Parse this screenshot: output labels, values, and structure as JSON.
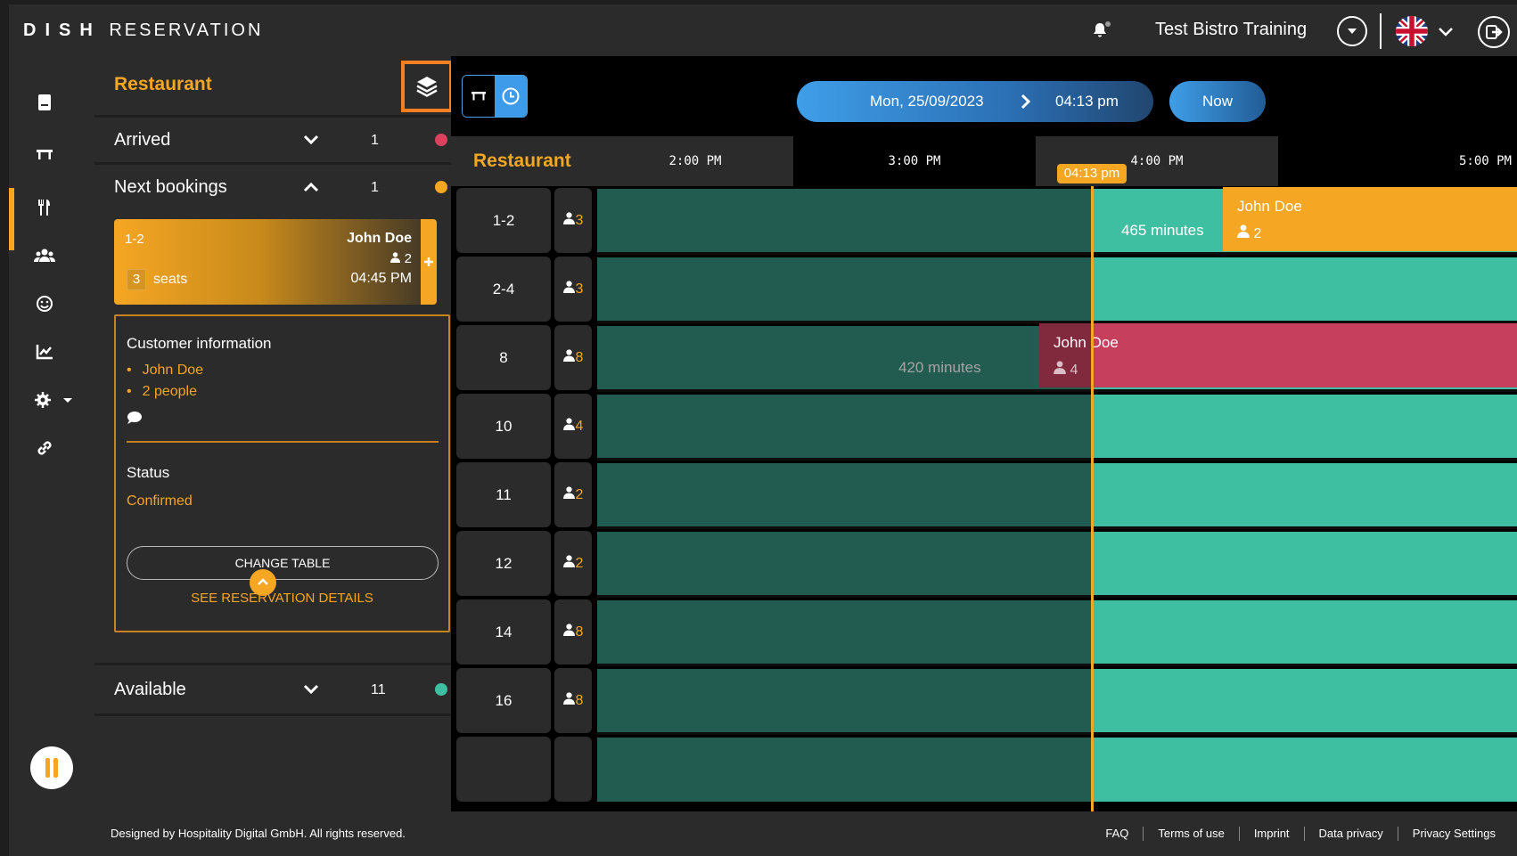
{
  "header": {
    "brand_bold": "DISH",
    "brand_rest": "RESERVATION",
    "venue": "Test Bistro Training"
  },
  "panel": {
    "title": "Restaurant",
    "sections": {
      "arrived": {
        "label": "Arrived",
        "count": "1",
        "color": "#d9415f"
      },
      "next": {
        "label": "Next bookings",
        "count": "1",
        "color": "#f5a623"
      },
      "available": {
        "label": "Available",
        "count": "11",
        "color": "#3fbfa1"
      }
    },
    "booking": {
      "table": "1-2",
      "name": "John Doe",
      "people": "2",
      "seats_num": "3",
      "seats_label": "seats",
      "time": "04:45 PM"
    },
    "customer": {
      "title": "Customer information",
      "name": "John Doe",
      "people": "2 people",
      "status_label": "Status",
      "status": "Confirmed",
      "change_table": "CHANGE TABLE",
      "details": "SEE RESERVATION DETAILS"
    }
  },
  "timeline": {
    "date": "Mon, 25/09/2023",
    "time": "04:13 pm",
    "now_button": "Now",
    "area_label": "Restaurant",
    "hours": [
      "2:00 PM",
      "3:00 PM",
      "4:00 PM",
      "5:00 PM"
    ],
    "now_tag": "04:13 pm",
    "rows": [
      {
        "table": "1-2",
        "cap": "3"
      },
      {
        "table": "2-4",
        "cap": "3"
      },
      {
        "table": "8",
        "cap": "8"
      },
      {
        "table": "10",
        "cap": "4"
      },
      {
        "table": "11",
        "cap": "2"
      },
      {
        "table": "12",
        "cap": "2"
      },
      {
        "table": "14",
        "cap": "8"
      },
      {
        "table": "16",
        "cap": "8"
      }
    ],
    "bookings": {
      "orange": {
        "name": "John Doe",
        "people": "2",
        "minutes": "465 minutes"
      },
      "red": {
        "name": "John Doe",
        "people": "4",
        "minutes": "420 minutes"
      }
    }
  },
  "footer": {
    "copyright": "Designed by Hospitality Digital GmbH. All rights reserved.",
    "links": [
      "FAQ",
      "Terms of use",
      "Imprint",
      "Data privacy",
      "Privacy Settings"
    ]
  },
  "colors": {
    "accent": "#f5a623",
    "blue": "#3d9be9",
    "teal": "#3fbfa1",
    "teal_dark": "#225b4f",
    "red": "#c6405e"
  }
}
